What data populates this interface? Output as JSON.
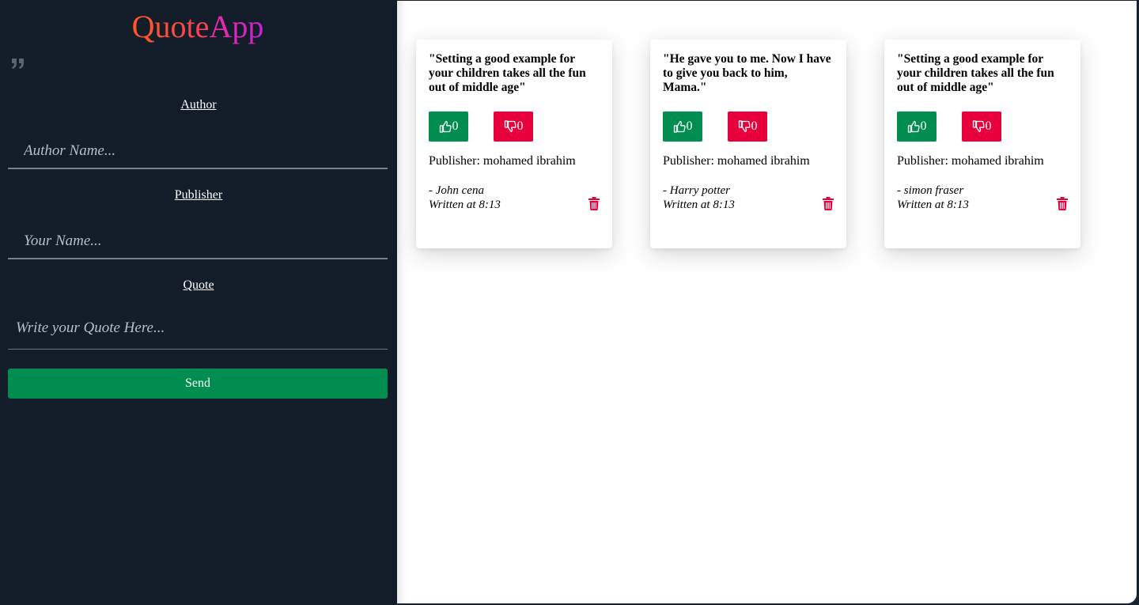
{
  "brand": {
    "part1": "Quote",
    "part2": "App"
  },
  "form": {
    "author_label": "Author",
    "author_placeholder": "Author Name...",
    "publisher_label": "Publisher",
    "publisher_placeholder": "Your Name...",
    "quote_label": "Quote",
    "quote_placeholder": "Write your Quote Here...",
    "send_label": "Send"
  },
  "colors": {
    "sidebar_bg": "#131d2a",
    "like": "#008d4f",
    "dislike": "#e8003d",
    "delete": "#e8003d"
  },
  "cards": [
    {
      "quote": "\"Setting a good example for your children takes all the fun out of middle age\"",
      "likes": "0",
      "dislikes": "0",
      "publisher": "Publisher: mohamed ibrahim",
      "author": "- John cena",
      "written": "Written at 8:13"
    },
    {
      "quote": "\"He gave you to me. Now I have to give you back to him, Mama.\"",
      "likes": "0",
      "dislikes": "0",
      "publisher": "Publisher: mohamed ibrahim",
      "author": "- Harry potter",
      "written": "Written at 8:13"
    },
    {
      "quote": "\"Setting a good example for your children takes all the fun out of middle age\"",
      "likes": "0",
      "dislikes": "0",
      "publisher": "Publisher: mohamed ibrahim",
      "author": "- simon fraser",
      "written": "Written at 8:13"
    }
  ]
}
